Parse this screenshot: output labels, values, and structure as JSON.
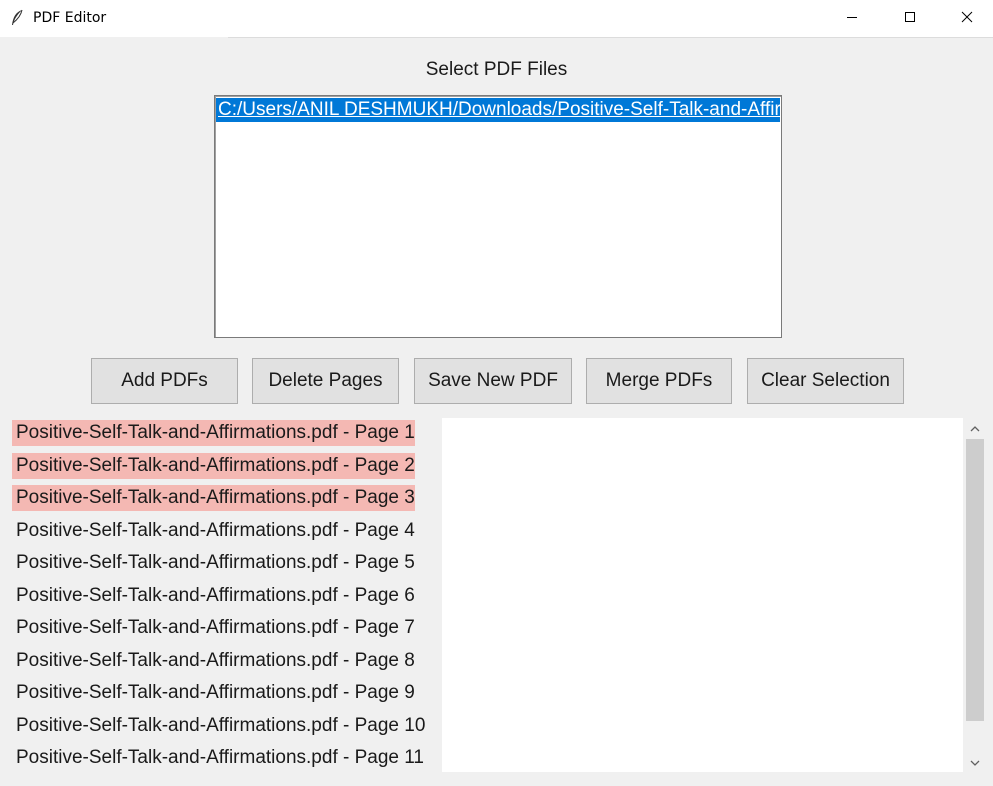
{
  "window": {
    "title": "PDF Editor",
    "app_icon": "feather-icon",
    "controls": [
      "minimize-icon",
      "maximize-icon",
      "close-icon"
    ]
  },
  "heading": "Select PDF Files",
  "file_list": {
    "items": [
      {
        "label": "C:/Users/ANIL DESHMUKH/Downloads/Positive-Self-Talk-and-Affirmations.pdf",
        "selected": true
      }
    ]
  },
  "toolbar": {
    "add_label": "Add PDFs",
    "delete_label": "Delete Pages",
    "save_label": "Save New PDF",
    "merge_label": "Merge PDFs",
    "clear_label": "Clear Selection"
  },
  "pages_list": {
    "items": [
      {
        "label": "Positive-Self-Talk-and-Affirmations.pdf - Page 1",
        "selected": true
      },
      {
        "label": "Positive-Self-Talk-and-Affirmations.pdf - Page 2",
        "selected": true
      },
      {
        "label": "Positive-Self-Talk-and-Affirmations.pdf - Page 3",
        "selected": true
      },
      {
        "label": "Positive-Self-Talk-and-Affirmations.pdf - Page 4",
        "selected": false
      },
      {
        "label": "Positive-Self-Talk-and-Affirmations.pdf - Page 5",
        "selected": false
      },
      {
        "label": "Positive-Self-Talk-and-Affirmations.pdf - Page 6",
        "selected": false
      },
      {
        "label": "Positive-Self-Talk-and-Affirmations.pdf - Page 7",
        "selected": false
      },
      {
        "label": "Positive-Self-Talk-and-Affirmations.pdf - Page 8",
        "selected": false
      },
      {
        "label": "Positive-Self-Talk-and-Affirmations.pdf - Page 9",
        "selected": false
      },
      {
        "label": "Positive-Self-Talk-and-Affirmations.pdf - Page 10",
        "selected": false
      },
      {
        "label": "Positive-Self-Talk-and-Affirmations.pdf - Page 11",
        "selected": false
      }
    ]
  },
  "colors": {
    "file_selection": "#0078d7",
    "page_selection": "#f4b8b3",
    "background": "#f0f0f0"
  }
}
